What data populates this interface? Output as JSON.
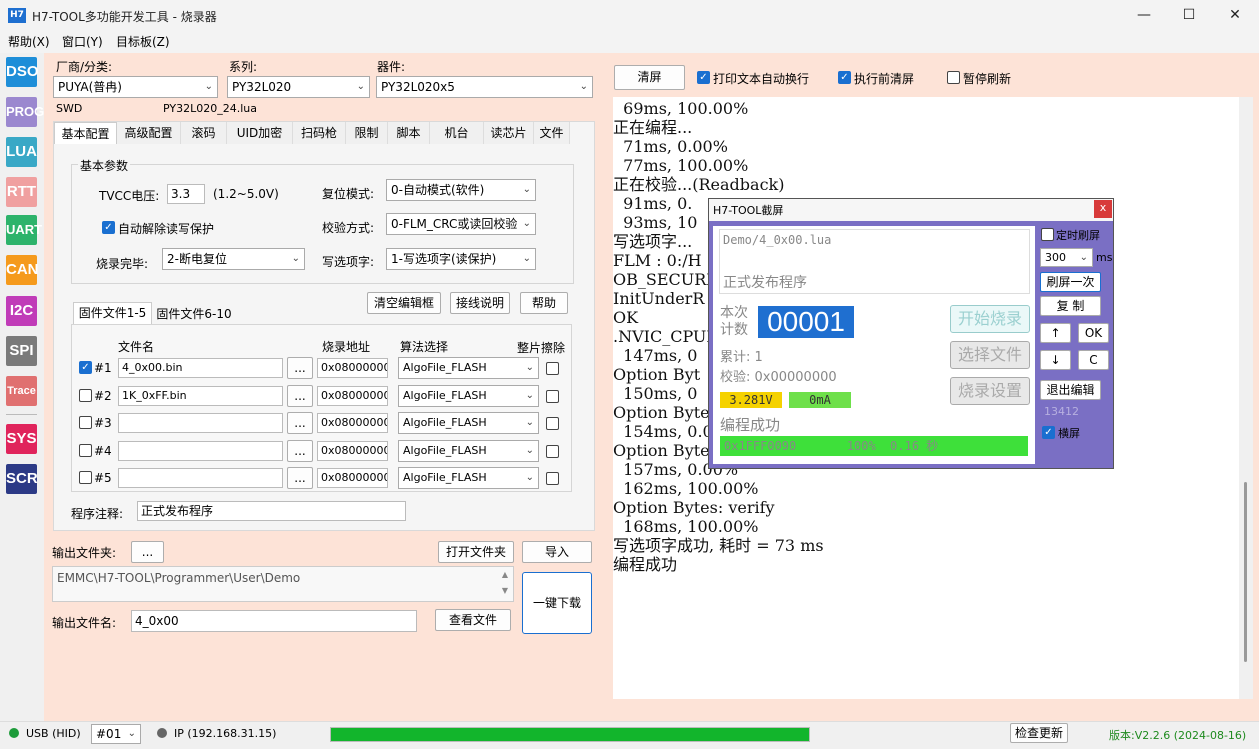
{
  "window": {
    "logo": "H7",
    "title": "H7-TOOL多功能开发工具 - 烧录器",
    "minimize": "—",
    "maximize": "☐",
    "close": "✕"
  },
  "menu": [
    "帮助(X)",
    "窗口(Y)",
    "目标板(Z)"
  ],
  "tools": [
    "DSO",
    "PROG",
    "LUA",
    "RTT",
    "UART",
    "CAN",
    "I2C",
    "SPI",
    "Trace",
    "SYS",
    "SCR"
  ],
  "toolcolors": [
    "#1e8ed8",
    "#9b88cf",
    "#39a8c6",
    "#f0a0a0",
    "#2db36b",
    "#f59a1c",
    "#c03cb8",
    "#7a7a7a",
    "#e07070",
    "#e0245c",
    "#2c3a86"
  ],
  "selector": {
    "vendor_label": "厂商/分类:",
    "vendor": "PUYA(普冉)",
    "series_label": "系列:",
    "series": "PY32L020",
    "device_label": "器件:",
    "device": "PY32L020x5",
    "iface": "SWD",
    "lua": "PY32L020_24.lua"
  },
  "tabs": [
    "基本配置",
    "高级配置",
    "滚码",
    "UID加密",
    "扫码枪",
    "限制",
    "脚本",
    "机台",
    "读芯片",
    "文件"
  ],
  "basic": {
    "group": "基本参数",
    "tvcc_label": "TVCC电压:",
    "tvcc": "3.3",
    "tvcc_range": "(1.2~5.0V)",
    "reset_label": "复位模式:",
    "reset": "0-自动模式(软件)",
    "unlock": "自动解除读写保护",
    "verify_label": "校验方式:",
    "verify": "0-FLM_CRC或读回校验",
    "done_label": "烧录完毕:",
    "done": "2-断电复位",
    "opt_label": "写选项字:",
    "opt": "1-写选项字(读保护)"
  },
  "files": {
    "tab1": "固件文件1-5",
    "tab2": "固件文件6-10",
    "clear": "清空编辑框",
    "wiring": "接线说明",
    "help": "帮助",
    "h_name": "文件名",
    "h_addr": "烧录地址",
    "h_algo": "算法选择",
    "h_erase": "整片擦除",
    "browse": "...",
    "rows": [
      {
        "id": "#1",
        "on": true,
        "name": "4_0x00.bin",
        "addr": "0x08000000",
        "algo": "AlgoFile_FLASH"
      },
      {
        "id": "#2",
        "on": false,
        "name": "1K_0xFF.bin",
        "addr": "0x08000000",
        "algo": "AlgoFile_FLASH"
      },
      {
        "id": "#3",
        "on": false,
        "name": "",
        "addr": "0x08000000",
        "algo": "AlgoFile_FLASH"
      },
      {
        "id": "#4",
        "on": false,
        "name": "",
        "addr": "0x08000000",
        "algo": "AlgoFile_FLASH"
      },
      {
        "id": "#5",
        "on": false,
        "name": "",
        "addr": "0x08000000",
        "algo": "AlgoFile_FLASH"
      }
    ],
    "note_label": "程序注释:",
    "note": "正式发布程序"
  },
  "output": {
    "folder_label": "输出文件夹:",
    "browse": "...",
    "open": "打开文件夹",
    "import": "导入",
    "path": "EMMC\\H7-TOOL\\Programmer\\User\\Demo",
    "name_label": "输出文件名:",
    "name": "4_0x00",
    "view": "查看文件",
    "download": "一键下载"
  },
  "log": {
    "clear": "清屏",
    "wrap": "打印文本自动换行",
    "preclear": "执行前清屏",
    "pause": "暂停刷新",
    "lines": [
      "  69ms, 100.00%",
      "正在编程...",
      "  71ms, 0.00%",
      "  77ms, 100.00%",
      "正在校验...(Readback)",
      "  91ms, 0.",
      "  93ms, 10",
      "",
      "写选项字...",
      "FLM : 0:/H                                    20xx_OPT.FLM",
      "OB_SECURE_",
      "InitUnderR",
      "OK",
      ".NVIC_CPUI",
      "  147ms, 0",
      "",
      "Option Byt",
      "  150ms, 0",
      "",
      "Option Bytes: erase_sector()",
      "  154ms, 0.00%",
      "",
      "Option Bytes: program_page()",
      "  157ms, 0.00%",
      "  162ms, 100.00%",
      "",
      "Option Bytes: verify",
      "  168ms, 100.00%",
      "写选项字成功, 耗时 = 73 ms",
      "编程成功"
    ]
  },
  "popup": {
    "title": "H7-TOOL截屏",
    "close": "x",
    "file": "Demo/4_0x00.lua",
    "desc": "正式发布程序",
    "count_label": "本次\n计数",
    "count": "00001",
    "start": "开始烧录",
    "choose": "选择文件",
    "settings": "烧录设置",
    "total": "累计: 1",
    "check": "校验: 0x00000000",
    "voltage": "3.281V",
    "current": "0mA",
    "status": "编程成功",
    "progress": "0x1FFF0090       100%  0.16 秒",
    "timer": "定时刷屏",
    "interval": "300",
    "unit": "ms",
    "refresh": "刷屏一次",
    "copy": "复 制",
    "up": "↑",
    "ok": "OK",
    "down": "↓",
    "c": "C",
    "exit": "退出编辑",
    "num": "13412",
    "landscape": "横屏"
  },
  "status": {
    "usb": "USB (HID)",
    "port": "#01",
    "ip": "IP (192.168.31.15)",
    "update": "检查更新",
    "version": "版本:V2.2.6 (2024-08-16)"
  }
}
